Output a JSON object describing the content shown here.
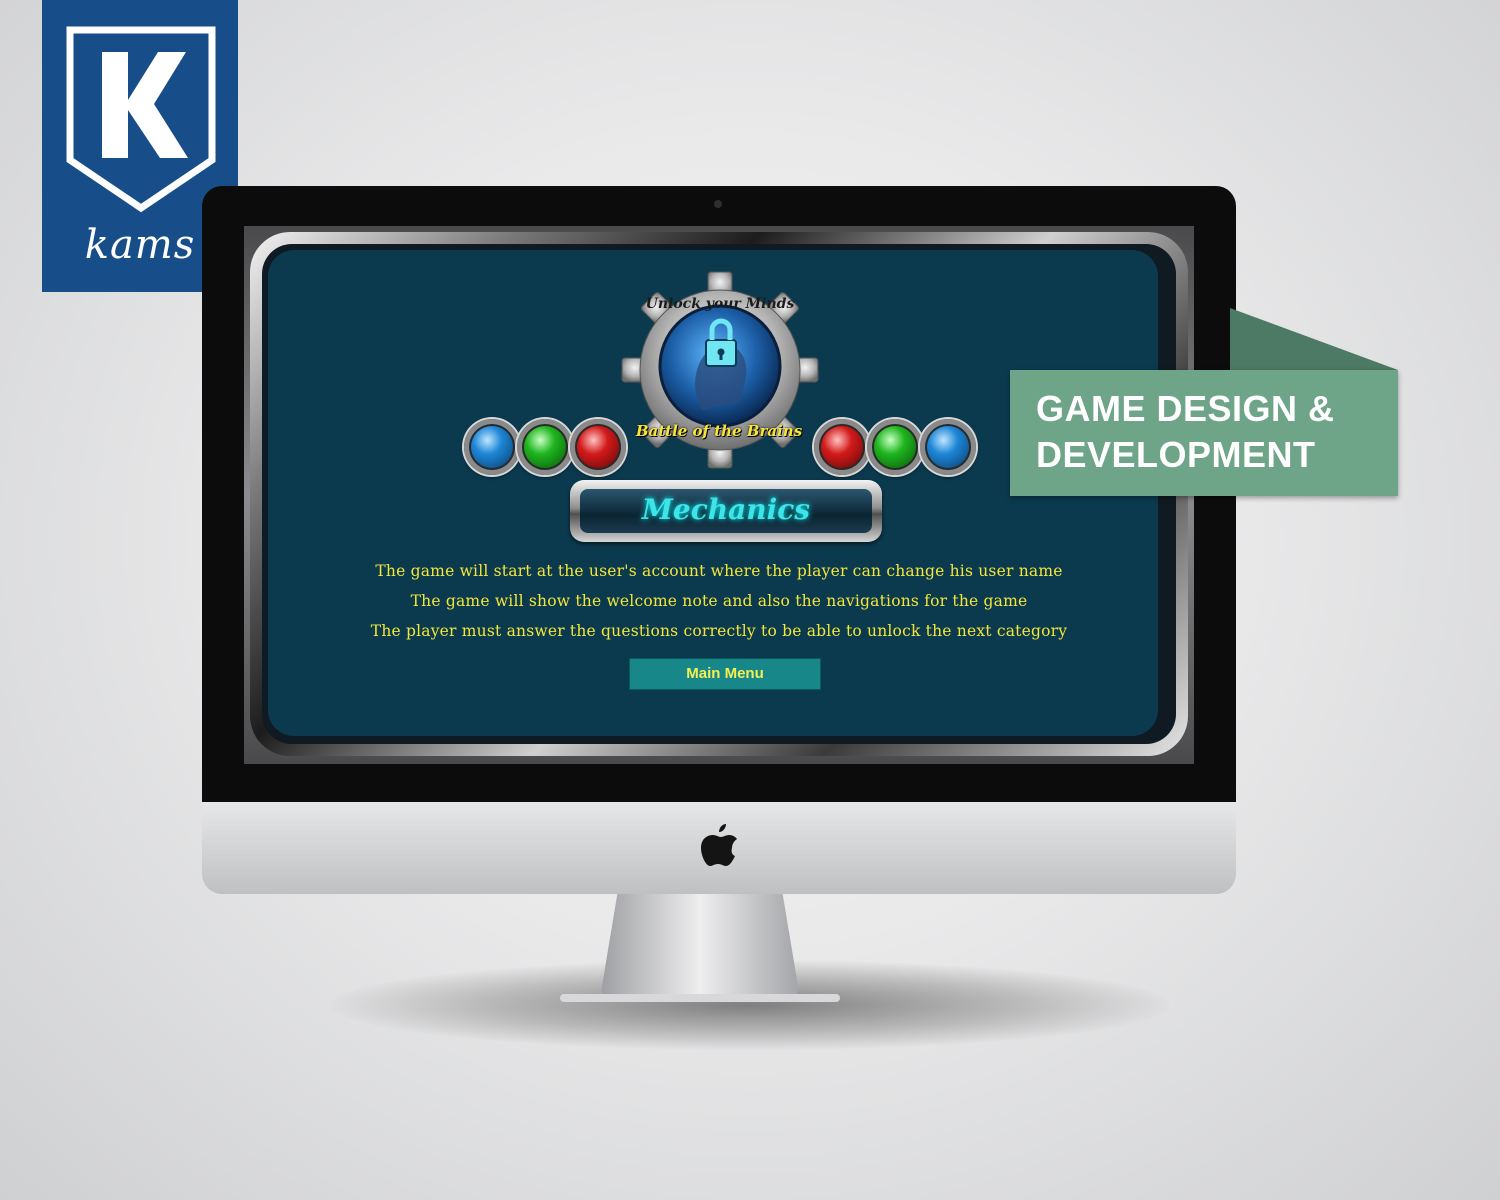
{
  "brand": {
    "wordmark": "kams",
    "badge_color": "#174e8a"
  },
  "banner": {
    "line1": "GAME DESIGN &",
    "line2": "DEVELOPMENT",
    "color": "#6ea487"
  },
  "game": {
    "emblem_top_text": "Unlock your Minds",
    "emblem_bottom_text": "Battle of the Brains",
    "emblem_icon": "padlock-head-gear-icon",
    "orbs_left": [
      "blue",
      "green",
      "red"
    ],
    "orbs_right": [
      "red",
      "green",
      "blue"
    ],
    "screen_title": "Mechanics",
    "mechanics": [
      "The game will start at the user's account where the player can change his user name",
      "The game will show the welcome note and also the navigations for the game",
      "The player must answer the questions correctly to be able to unlock the next category"
    ],
    "main_menu_label": "Main Menu",
    "background_color": "#0b3a4f",
    "text_color": "#f2e63a"
  },
  "device": {
    "logo_icon": "apple-logo-icon"
  }
}
